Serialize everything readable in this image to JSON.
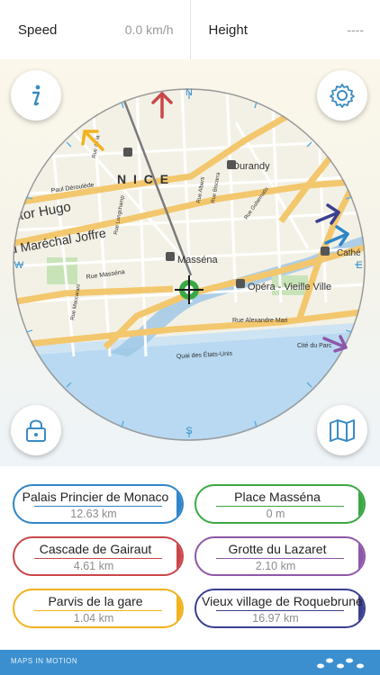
{
  "header": {
    "speed_label": "Speed",
    "speed_value": "0.0 km/h",
    "height_label": "Height",
    "height_value": "----"
  },
  "map": {
    "compass": {
      "north": "N",
      "south": "S",
      "east": "E",
      "west": "W"
    },
    "labels": {
      "city": "N I C E",
      "durandy": "Durandy",
      "massena": "Masséna",
      "opera": "Opéra - Vieille Ville",
      "cathe": "Cathé",
      "victor_hugo": "ictor Hugo",
      "marechal": "u Maréchal Joffre",
      "paul_deroulede": "Paul Déroulède",
      "rue_massena": "Rue Masséna",
      "rue_alexandre": "Rue Alexandre Mari",
      "quai": "Quai des États-Unis",
      "cite_parc": "Cité du Parc",
      "rue_gubernatis": "Rue Gubernatis",
      "rue_longchamp": "Rue Longchamp",
      "rue_maccarani": "Rue Maccarani",
      "rue_alberti": "Rue Alberti",
      "rue_biscarra": "Rue Biscarra",
      "rue_de_la": "Rue de la"
    },
    "buttons": {
      "info": "info-icon",
      "settings": "gear-icon",
      "lock": "lock-icon",
      "map": "map-icon"
    }
  },
  "destinations": [
    {
      "name": "Palais Princier de Monaco",
      "distance": "12.63 km",
      "color": "#2e86c8"
    },
    {
      "name": "Place Masséna",
      "distance": "0 m",
      "color": "#3aa843"
    },
    {
      "name": "Cascade de Gairaut",
      "distance": "4.61 km",
      "color": "#c9474a"
    },
    {
      "name": "Grotte du Lazaret",
      "distance": "2.10 km",
      "color": "#8e57a8"
    },
    {
      "name": "Parvis de la gare",
      "distance": "1.04 km",
      "color": "#f1b21d"
    },
    {
      "name": "Vieux village de Roquebrune",
      "distance": "16.97 km",
      "color": "#3a3f8f"
    }
  ],
  "footer": {
    "brand": "MAPS IN MOTION",
    "logo_icon": "footprints-icon"
  }
}
